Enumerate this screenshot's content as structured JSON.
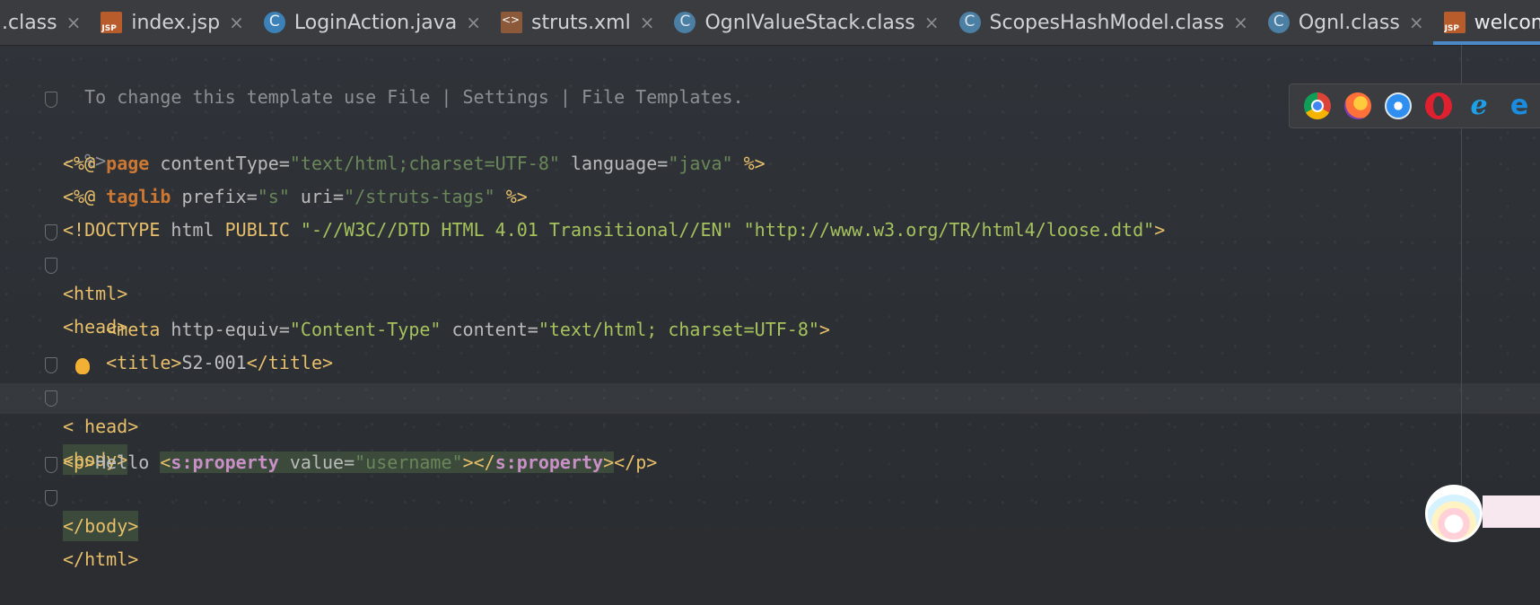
{
  "tabs": [
    {
      "label": ".class",
      "icon": "none",
      "active": false
    },
    {
      "label": "index.jsp",
      "icon": "jsp-file-icon",
      "active": false
    },
    {
      "label": "LoginAction.java",
      "icon": "java-class-icon",
      "active": false
    },
    {
      "label": "struts.xml",
      "icon": "xml-file-icon",
      "active": false
    },
    {
      "label": "OgnlValueStack.class",
      "icon": "class-file-icon",
      "active": false
    },
    {
      "label": "ScopesHashModel.class",
      "icon": "class-file-icon",
      "active": false
    },
    {
      "label": "Ognl.class",
      "icon": "class-file-icon",
      "active": false
    },
    {
      "label": "welcome.jsp",
      "icon": "jsp-file-icon",
      "active": true
    }
  ],
  "tab_close_glyph": "×",
  "code": {
    "l1": "  To change this template use File | Settings | File Templates.",
    "l2": "--%>",
    "l3": {
      "open": "<%@ ",
      "kw": "page",
      "a1": " contentType=",
      "v1": "\"text/html;charset=UTF-8\"",
      "a2": " language=",
      "v2": "\"java\"",
      "close": " %>"
    },
    "l4": {
      "open": "<%@ ",
      "kw": "taglib",
      "a1": " prefix=",
      "v1": "\"s\"",
      "a2": " uri=",
      "v2": "\"/struts-tags\"",
      "close": " %>"
    },
    "l5": {
      "open": "<!DOCTYPE ",
      "a1": "html ",
      "kw": "PUBLIC",
      "s1": " \"-//W3C//DTD HTML 4.01 Transitional//EN\"",
      "s2": " \"http://www.w3.org/TR/html4/loose.dtd\"",
      "close": ">"
    },
    "l6": "<html>",
    "l7": "<head>",
    "l8": {
      "indent": "    ",
      "open": "<meta",
      "a1": " http-equiv=",
      "v1": "\"Content-Type\"",
      "a2": " content=",
      "v2": "\"text/html; charset=UTF-8\"",
      "close": ">"
    },
    "l9": {
      "indent": "    ",
      "open": "<title>",
      "text": "S2-001",
      "close": "</title>"
    },
    "l10_a": "<",
    "l10_b": "head>",
    "l11": "<body>",
    "l12": {
      "open": "<p>",
      "text": "Hello ",
      "t1": "<",
      "sp1": "s:property",
      "a1": " value=",
      "v1": "\"username\"",
      "t2": "></",
      "sp2": "s:property",
      "t3": ">",
      "close": "</p>"
    },
    "l13": "</body>",
    "l14": "</html>"
  },
  "colors": {
    "tag": "#e8bf6a",
    "keyword": "#cc7832",
    "value": "#6a8759",
    "string": "#a5c25c",
    "comment": "#8c8f93",
    "active_tab_underline": "#4a88c7"
  },
  "browsers": [
    "chrome-icon",
    "firefox-icon",
    "safari-icon",
    "opera-icon",
    "ie-icon",
    "edge-icon"
  ],
  "browser_glyphs": {
    "ie": "e",
    "edge": "e"
  }
}
